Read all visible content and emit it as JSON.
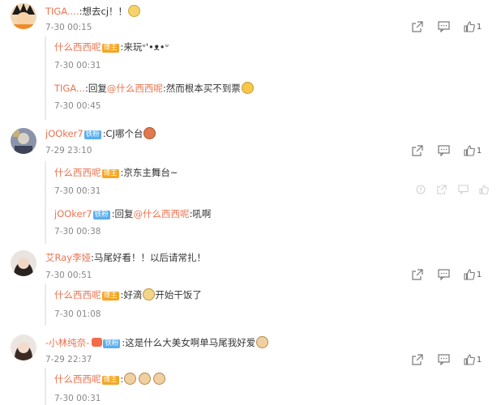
{
  "comments": [
    {
      "user": "TIGA....",
      "text": ":想去cj！！",
      "time": "7-30 00:15",
      "likes": "1",
      "replies": [
        {
          "user": "什么西西呢",
          "badge": "博主",
          "text": ":来玩ᐡ'•ᴥ•ᐡ",
          "time": "7-30 00:31"
        },
        {
          "user": "TIGA...",
          "prefix": ":回复",
          "mention": "@什么西西呢",
          "text": ":然而根本买不到票",
          "time": "7-30 00:45"
        }
      ]
    },
    {
      "user": "jOOker7",
      "badge": "铁粉",
      "text": ":CJ哪个台",
      "time": "7-29 23:10",
      "likes": "1",
      "replies": [
        {
          "user": "什么西西呢",
          "badge": "博主",
          "text": ":京东主舞台~",
          "time": "7-30 00:31"
        },
        {
          "user": "jOOker7",
          "badge": "铁粉",
          "prefix": ":回复",
          "mention": "@什么西西呢",
          "text": ":吼啊",
          "time": "7-30 00:38"
        }
      ]
    },
    {
      "user": "艾Ray李娅",
      "text": ":马尾好看！！以后请常扎！",
      "time": "7-30 00:51",
      "likes": "1",
      "replies": [
        {
          "user": "什么西西呢",
          "badge": "博主",
          "text": ":好滴",
          "text2": "开始干饭了",
          "time": "7-30 01:08"
        }
      ]
    },
    {
      "user": "-小林纯奈-",
      "badge": "铁粉",
      "text": ":这是什么大美女啊单马尾我好爱",
      "time": "7-29 22:37",
      "likes": "1",
      "replies": [
        {
          "user": "什么西西呢",
          "badge": "博主",
          "text": ":",
          "time": "7-30 00:31"
        }
      ]
    }
  ],
  "colors": {
    "name": "#eb7350",
    "badge_blogger": "#f5a623",
    "badge_fan": "#5aaef0"
  },
  "icons": [
    "share-icon",
    "comment-icon",
    "like-icon",
    "report-icon"
  ]
}
